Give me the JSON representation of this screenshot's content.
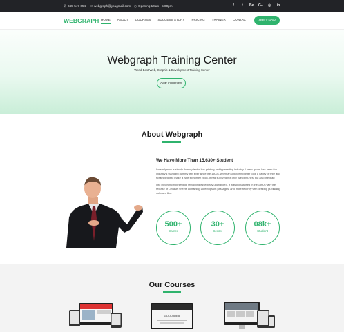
{
  "topbar": {
    "phone": "045-547-654",
    "email": "webgraph@yougmail.com",
    "hours": "Opening 10am - 5:00pm",
    "socials": [
      "f",
      "t",
      "Be",
      "G+",
      "◎",
      "in"
    ]
  },
  "header": {
    "logo": "WEBGRAPH",
    "nav": [
      "HOME",
      "ABOUT",
      "COURSES",
      "SUCCESS STORY",
      "PRICING",
      "TRAINER",
      "CONTACT"
    ],
    "active_index": 0,
    "apply_label": "APPLY NOW"
  },
  "hero": {
    "title": "Webgraph Training Center",
    "subtitle": "World Best Web, Graphic & Development Training Center",
    "button": "OUR COURSES"
  },
  "about": {
    "title": "About Webgraph",
    "heading": "We Have More Than 15,630+ Student",
    "para1": "Lorem Ipsum is simply dummy text of the printing and typesetting industry. Lorem Ipsum has been the industry's standard dummy text ever since the 1500s, when an unknown printer took a galley of type and scrambled it to make a type specimen book. It has survived not only five centuries, but also the leap",
    "para2": "into electronic typesetting, remaining essentially unchanged. It was popularised in the 1960s with the release of Letraset sheets containing Lorem Ipsum passages, and more recently with desktop publishing software like.",
    "stats": [
      {
        "value": "500+",
        "label": "trainer"
      },
      {
        "value": "30+",
        "label": "Center"
      },
      {
        "value": "08k+",
        "label": "Student"
      }
    ]
  },
  "courses": {
    "title": "Our Courses",
    "mockup_caption": "GOOD IDEA"
  },
  "colors": {
    "accent": "#2fb36d",
    "topbar": "#222327"
  }
}
